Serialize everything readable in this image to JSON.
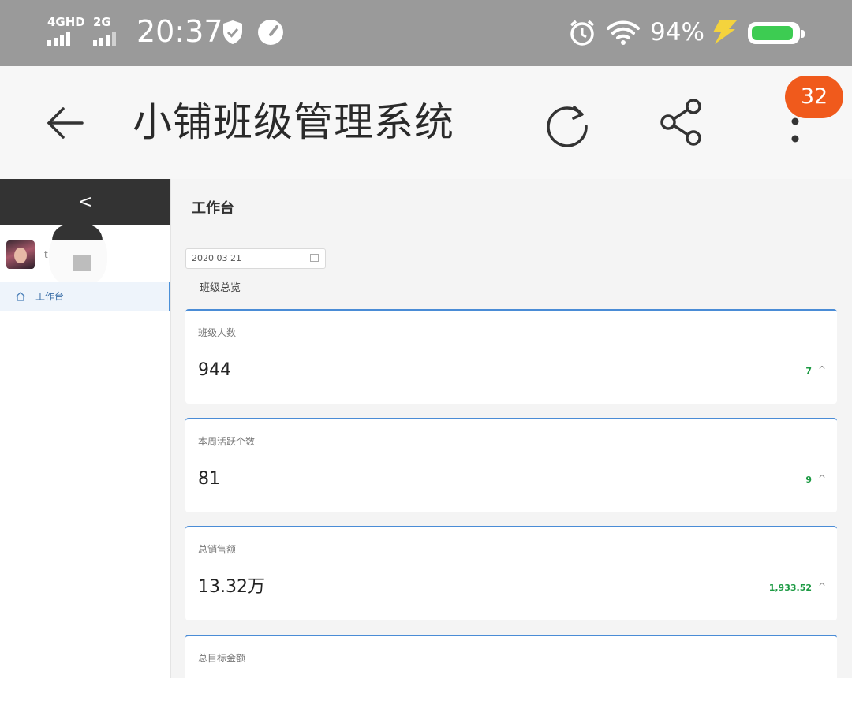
{
  "status_bar": {
    "signal1_label": "4GHD",
    "signal2_label": "2G",
    "time": "20:37",
    "battery_percent": "94%",
    "battery_level": 0.94,
    "icons": [
      "shield-icon",
      "speedometer-icon",
      "alarm-clock-icon",
      "wifi-icon",
      "charging-bolt-icon",
      "battery-icon"
    ]
  },
  "app_bar": {
    "title": "小铺班级管理系统",
    "badge_count": "32",
    "icons": [
      "back-arrow-icon",
      "refresh-icon",
      "share-icon",
      "more-vertical-icon"
    ]
  },
  "sidebar": {
    "collapse_glyph": "<",
    "user_initial": "t",
    "nav_items": [
      {
        "label": "工作台",
        "icon": "home-icon",
        "active": true
      }
    ]
  },
  "main": {
    "page_title": "工作台",
    "date_value": "2020 03 21",
    "section_title": "班级总览",
    "cards": [
      {
        "label": "班级人数",
        "value": "944",
        "delta": "7",
        "trend": "up"
      },
      {
        "label": "本周活跃个数",
        "value": "81",
        "delta": "9",
        "trend": "up"
      },
      {
        "label": "总销售额",
        "value": "13.32万",
        "delta": "1,933.52",
        "trend": "up"
      },
      {
        "label": "总目标金额"
      }
    ]
  },
  "colors": {
    "status_bar_bg": "#9a9a9a",
    "badge": "#f05a1c",
    "card_accent": "#4a8cd6",
    "delta_green": "#1c9a43",
    "battery_green": "#3dcc52"
  }
}
